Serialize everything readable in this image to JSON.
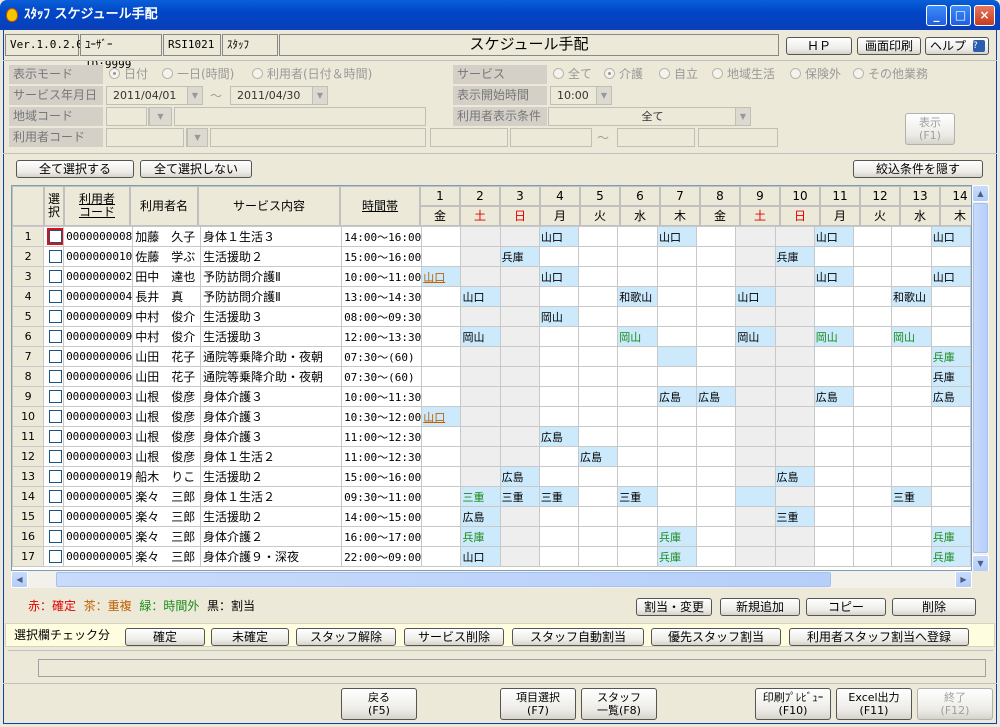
{
  "window": {
    "title": "ｽﾀｯﾌ スケジュール手配",
    "min": "_",
    "max": "□",
    "close": "×"
  },
  "info": {
    "version": "Ver.1.0.2.0",
    "user_id": "ﾕｰｻﾞｰID:9999",
    "code": "RSI1021",
    "staff": "ｽﾀｯﾌ",
    "page_title": "スケジュール手配"
  },
  "top_buttons": {
    "hp": "ＨＰ",
    "print": "画面印刷",
    "help": "ヘルプ"
  },
  "form": {
    "display_mode_label": "表示モード",
    "display_mode_opts": [
      "日付",
      "一日(時間)",
      "利用者(日付＆時間)"
    ],
    "year_month_label": "サービス年月日",
    "date_from": "2011/04/01",
    "tilde": "～",
    "date_to": "2011/04/30",
    "area_label": "地域コード",
    "user_code_label": "利用者コード",
    "service_label": "サービス",
    "service_opts": [
      "全て",
      "介護",
      "自立",
      "地域生活",
      "保険外",
      "その他業務"
    ],
    "start_time_label": "表示開始時間",
    "start_time": "10:00",
    "user_cond_label": "利用者表示条件",
    "user_cond": "全て",
    "show_button": "表示\n(F1)"
  },
  "select_all": "全て選択する",
  "deselect_all": "全て選択しない",
  "hide_filter": "絞込条件を隠す",
  "columns": {
    "select": "選\n択",
    "code": "利用者\nコード",
    "name": "利用者名",
    "service": "サービス内容",
    "time": "時間帯"
  },
  "days": [
    {
      "n": "1",
      "w": "金"
    },
    {
      "n": "2",
      "w": "土"
    },
    {
      "n": "3",
      "w": "日"
    },
    {
      "n": "4",
      "w": "月"
    },
    {
      "n": "5",
      "w": "火"
    },
    {
      "n": "6",
      "w": "水"
    },
    {
      "n": "7",
      "w": "木"
    },
    {
      "n": "8",
      "w": "金"
    },
    {
      "n": "9",
      "w": "土"
    },
    {
      "n": "10",
      "w": "日"
    },
    {
      "n": "11",
      "w": "月"
    },
    {
      "n": "12",
      "w": "火"
    },
    {
      "n": "13",
      "w": "水"
    },
    {
      "n": "14",
      "w": "木"
    }
  ],
  "rows": [
    {
      "no": "1",
      "code": "0000000008",
      "name": "加藤　久子",
      "service": "身体１生活３",
      "time": "14:00～16:00",
      "cells": {
        "4": "山口",
        "7": "山口",
        "11": "山口",
        "14": "山口"
      },
      "colors": {},
      "hi": [
        "4",
        "7",
        "11",
        "14"
      ]
    },
    {
      "no": "2",
      "code": "0000000010",
      "name": "佐藤　学ぶ",
      "service": "生活援助２",
      "time": "15:00～16:00",
      "cells": {
        "3": "兵庫",
        "10": "兵庫"
      },
      "colors": {},
      "hi": [
        "3",
        "10"
      ]
    },
    {
      "no": "3",
      "code": "0000000002",
      "name": "田中　達也",
      "service": "予防訪問介護Ⅱ",
      "time": "10:00～11:00",
      "cells": {
        "1": "山口",
        "4": "山口",
        "11": "山口",
        "14": "山口"
      },
      "colors": {
        "1": "brown"
      },
      "hi": [
        "1",
        "4",
        "11",
        "14"
      ]
    },
    {
      "no": "4",
      "code": "0000000004",
      "name": "長井　真",
      "service": "予防訪問介護Ⅱ",
      "time": "13:00～14:30",
      "cells": {
        "2": "山口",
        "6": "和歌山",
        "9": "山口",
        "13": "和歌山"
      },
      "colors": {},
      "hi": [
        "2",
        "6",
        "9",
        "13"
      ]
    },
    {
      "no": "5",
      "code": "0000000009",
      "name": "中村　俊介",
      "service": "生活援助３",
      "time": "08:00～09:30",
      "cells": {
        "4": "岡山"
      },
      "colors": {},
      "hi": [
        "4"
      ]
    },
    {
      "no": "6",
      "code": "0000000009",
      "name": "中村　俊介",
      "service": "生活援助３",
      "time": "12:00～13:30",
      "cells": {
        "2": "岡山",
        "6": "岡山",
        "9": "岡山",
        "11": "岡山",
        "13": "岡山"
      },
      "colors": {
        "6": "green",
        "11": "green",
        "13": "green"
      },
      "hi": [
        "2",
        "6",
        "9",
        "11",
        "13"
      ]
    },
    {
      "no": "7",
      "code": "0000000006",
      "name": "山田　花子",
      "service": "通院等乗降介助・夜朝",
      "time": "07:30～(60)",
      "cells": {
        "14": "兵庫"
      },
      "colors": {
        "14": "green"
      },
      "hi": [
        "7",
        "14"
      ]
    },
    {
      "no": "8",
      "code": "0000000006",
      "name": "山田　花子",
      "service": "通院等乗降介助・夜朝",
      "time": "07:30～(60)",
      "cells": {
        "14": "兵庫"
      },
      "colors": {},
      "hi": [
        "14"
      ]
    },
    {
      "no": "9",
      "code": "0000000003",
      "name": "山根　俊彦",
      "service": "身体介護３",
      "time": "10:00～11:30",
      "cells": {
        "7": "広島",
        "8": "広島",
        "11": "広島",
        "14": "広島"
      },
      "colors": {},
      "hi": [
        "7",
        "8",
        "11",
        "14"
      ]
    },
    {
      "no": "10",
      "code": "0000000003",
      "name": "山根　俊彦",
      "service": "身体介護３",
      "time": "10:30～12:00",
      "cells": {
        "1": "山口"
      },
      "colors": {
        "1": "brown"
      },
      "hi": [
        "1"
      ]
    },
    {
      "no": "11",
      "code": "0000000003",
      "name": "山根　俊彦",
      "service": "身体介護３",
      "time": "11:00～12:30",
      "cells": {
        "4": "広島"
      },
      "colors": {},
      "hi": [
        "4"
      ]
    },
    {
      "no": "12",
      "code": "0000000003",
      "name": "山根　俊彦",
      "service": "身体１生活２",
      "time": "11:00～12:30",
      "cells": {
        "5": "広島"
      },
      "colors": {},
      "hi": [
        "5"
      ]
    },
    {
      "no": "13",
      "code": "0000000019",
      "name": "船木　りこ",
      "service": "生活援助２",
      "time": "15:00～16:00",
      "cells": {
        "3": "広島",
        "10": "広島"
      },
      "colors": {},
      "hi": [
        "3",
        "10"
      ]
    },
    {
      "no": "14",
      "code": "0000000005",
      "name": "楽々　三郎",
      "service": "身体１生活２",
      "time": "09:30～11:00",
      "cells": {
        "2": "三重",
        "3": "三重",
        "4": "三重",
        "6": "三重",
        "13": "三重"
      },
      "colors": {
        "2": "green"
      },
      "hi": [
        "2",
        "3",
        "4",
        "6",
        "9",
        "13"
      ]
    },
    {
      "no": "15",
      "code": "0000000005",
      "name": "楽々　三郎",
      "service": "生活援助２",
      "time": "14:00～15:00",
      "cells": {
        "2": "広島",
        "10": "三重"
      },
      "colors": {},
      "hi": [
        "2",
        "10"
      ]
    },
    {
      "no": "16",
      "code": "0000000005",
      "name": "楽々　三郎",
      "service": "身体介護２",
      "time": "16:00～17:00",
      "cells": {
        "2": "兵庫",
        "7": "兵庫",
        "14": "兵庫"
      },
      "colors": {
        "2": "green",
        "7": "green",
        "14": "green"
      },
      "hi": [
        "2",
        "7",
        "14"
      ]
    },
    {
      "no": "17",
      "code": "0000000005",
      "name": "楽々　三郎",
      "service": "身体介護９・深夜",
      "time": "22:00～09:00",
      "cells": {
        "2": "山口",
        "7": "兵庫",
        "14": "兵庫"
      },
      "colors": {
        "7": "green",
        "14": "green"
      },
      "hi": [
        "2",
        "7",
        "14"
      ]
    }
  ],
  "legend": {
    "red": "赤：確定",
    "brown": "茶：重複",
    "green": "緑：時間外",
    "black": "黒：割当"
  },
  "actions": {
    "assign": "割当・変更",
    "add": "新規追加",
    "copy": "コピー",
    "delete": "削除"
  },
  "bottom": {
    "label": "選択欄チェック分",
    "confirm": "確定",
    "unconfirm": "未確定",
    "staff_release": "スタッフ解除",
    "service_delete": "サービス削除",
    "auto_assign": "スタッフ自動割当",
    "priority_assign": "優先スタッフ割当",
    "register": "利用者スタッフ割当へ登録"
  },
  "fkeys": {
    "back": "戻る\n(F5)",
    "item_select": "項目選択\n(F7)",
    "staff_list": "スタッフ\n一覧(F8)",
    "print_preview": "印刷ﾌﾟﾚﾋﾞｭｰ\n(F10)",
    "excel": "Excel出力\n(F11)",
    "end": "終了\n(F12)"
  }
}
